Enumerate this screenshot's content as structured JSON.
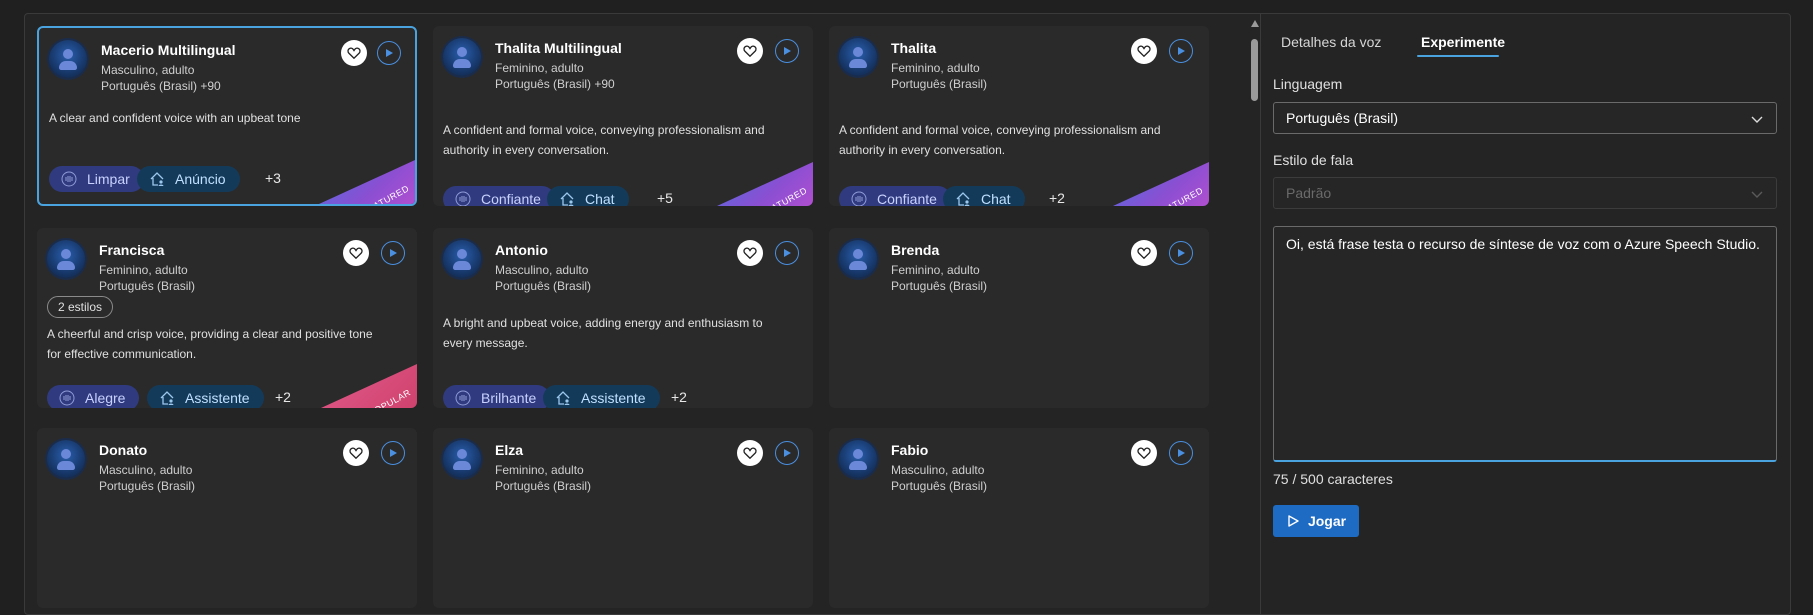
{
  "colors": {
    "accent": "#4aa3df",
    "primary_button": "#1e6bc4",
    "featured_ribbon": "#8a4fd2",
    "popular_ribbon": "#d0426e"
  },
  "cards": [
    {
      "name": "Macerio Multilingual",
      "gender_age": "Masculino, adulto",
      "locale": "Português (Brasil) +90",
      "description": "A clear and confident voice with an upbeat tone",
      "style_tag": "Limpar",
      "role_tag": "Anúncio",
      "more": "+3",
      "ribbon": "FEATURED",
      "selected": true
    },
    {
      "name": "Thalita Multilingual",
      "gender_age": "Feminino, adulto",
      "locale": "Português (Brasil) +90",
      "description": "A confident and formal voice, conveying professionalism and authority in every conversation.",
      "style_tag": "Confiante",
      "role_tag": "Chat",
      "more": "+5",
      "ribbon": "FEATURED"
    },
    {
      "name": "Thalita",
      "gender_age": "Feminino, adulto",
      "locale": "Português (Brasil)",
      "description": "A confident and formal voice, conveying professionalism and authority in every conversation.",
      "style_tag": "Confiante",
      "role_tag": "Chat",
      "more": "+2",
      "ribbon": "FEATURED"
    },
    {
      "name": "Francisca",
      "gender_age": "Feminino, adulto",
      "locale": "Português (Brasil)",
      "styles_count": "2 estilos",
      "description": "A cheerful and crisp voice, providing a clear and positive tone for effective communication.",
      "style_tag": "Alegre",
      "role_tag": "Assistente",
      "more": "+2",
      "ribbon": "POPULAR"
    },
    {
      "name": "Antonio",
      "gender_age": "Masculino, adulto",
      "locale": "Português (Brasil)",
      "description": "A bright and upbeat voice, adding energy and enthusiasm to every message.",
      "style_tag": "Brilhante",
      "role_tag": "Assistente",
      "more": "+2"
    },
    {
      "name": "Brenda",
      "gender_age": "Feminino, adulto",
      "locale": "Português (Brasil)"
    },
    {
      "name": "Donato",
      "gender_age": "Masculino, adulto",
      "locale": "Português (Brasil)"
    },
    {
      "name": "Elza",
      "gender_age": "Feminino, adulto",
      "locale": "Português (Brasil)"
    },
    {
      "name": "Fabio",
      "gender_age": "Masculino, adulto",
      "locale": "Português (Brasil)"
    }
  ],
  "panel": {
    "tabs": [
      {
        "label": "Detalhes da voz"
      },
      {
        "label": "Experimente",
        "active": true
      }
    ],
    "language_label": "Linguagem",
    "language_value": "Português (Brasil)",
    "style_label": "Estilo de fala",
    "style_value": "Padrão",
    "text_value": "Oi, está frase testa o recurso de síntese de voz com o Azure Speech Studio.",
    "counter": "75 / 500 caracteres",
    "play_label": "Jogar"
  },
  "icons": {
    "favorite": "heart-outline-icon",
    "play": "play-circle-icon",
    "style": "waveform-icon",
    "role": "house-person-icon",
    "chevron": "chevron-down-icon"
  }
}
